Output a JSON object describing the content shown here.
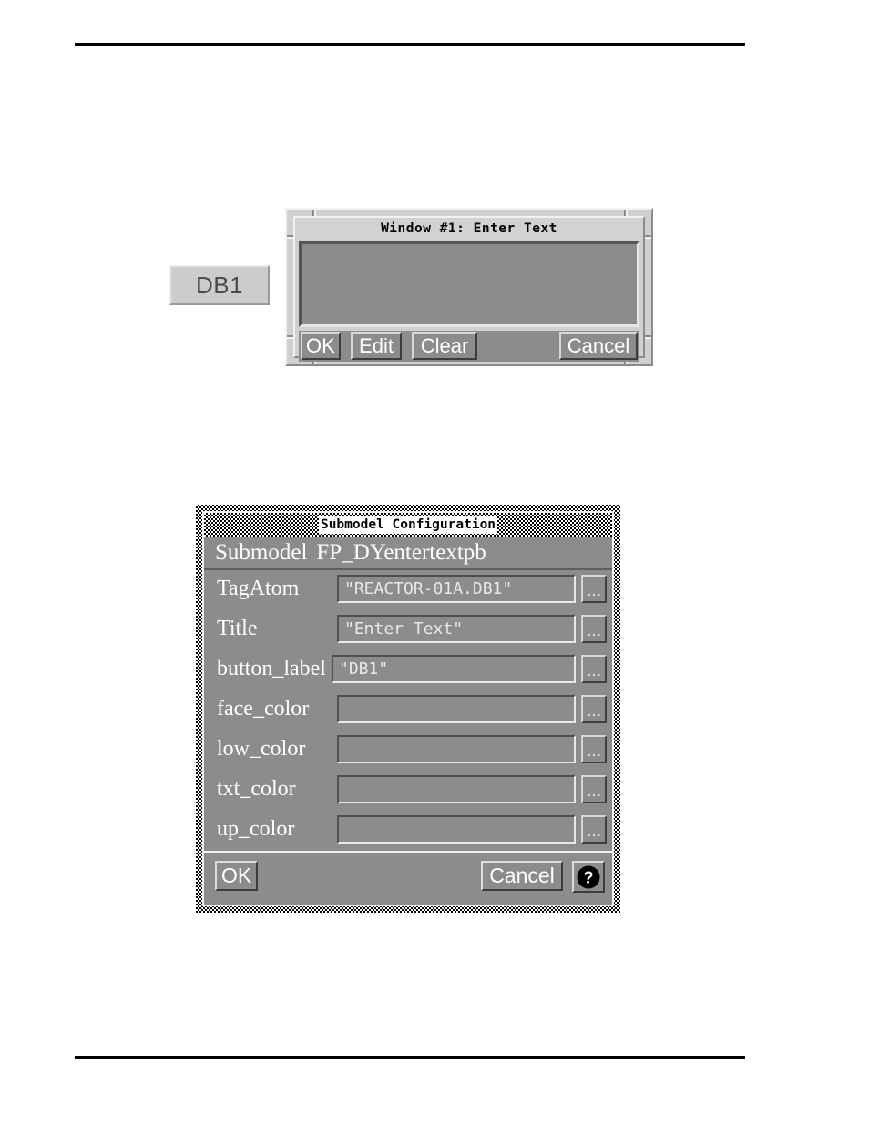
{
  "page": {
    "rules": [
      "top-rule",
      "bottom-rule"
    ]
  },
  "db1_button": {
    "label": "DB1",
    "name": "db1-button"
  },
  "enter_text_window": {
    "title": "Window #1: Enter Text",
    "textarea_value": "",
    "buttons": [
      {
        "label": "OK",
        "name": "ok-button"
      },
      {
        "label": "Edit",
        "name": "edit-button"
      },
      {
        "label": "Clear",
        "name": "clear-button"
      },
      {
        "label": "Cancel",
        "name": "cancel-button"
      }
    ]
  },
  "submodel_config": {
    "title": "Submodel Configuration",
    "submodel_label": "Submodel",
    "submodel_name": "FP_DYentertextpb",
    "ellipsis_label": "...",
    "fields": [
      {
        "label": "TagAtom",
        "value": "\"REACTOR-01A.DB1\""
      },
      {
        "label": "Title",
        "value": "\"Enter Text\""
      },
      {
        "label": "button_label",
        "value": "\"DB1\""
      },
      {
        "label": "face_color",
        "value": ""
      },
      {
        "label": "low_color",
        "value": ""
      },
      {
        "label": "txt_color",
        "value": ""
      },
      {
        "label": "up_color",
        "value": ""
      }
    ],
    "ok_label": "OK",
    "cancel_label": "Cancel",
    "help_label": "?"
  },
  "colors": {
    "page_background": "#ffffff",
    "dialog_face": "#8c8c8c",
    "window_frame": "#d0d0d0",
    "button_face_light": "#cccccc",
    "text_white": "#ffffff",
    "text_black": "#000000",
    "rule": "#000000"
  }
}
